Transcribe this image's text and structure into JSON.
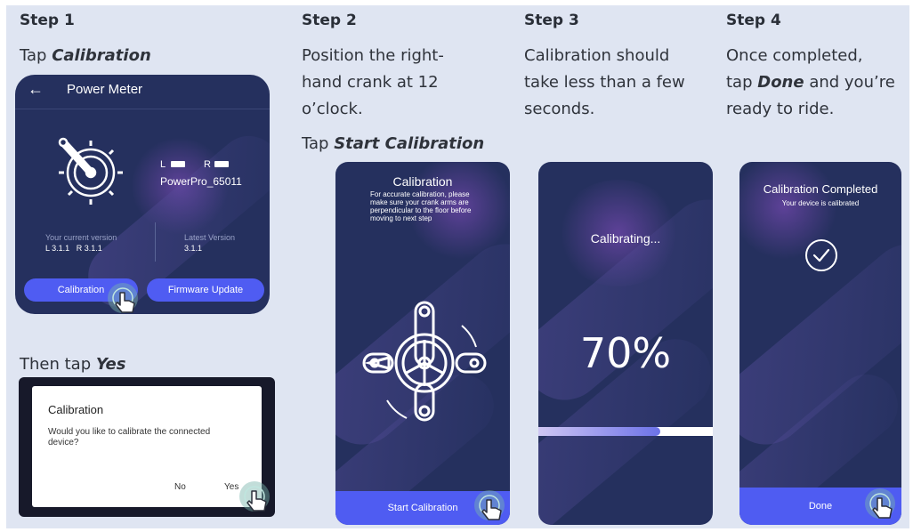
{
  "steps": [
    {
      "title": "Step 1",
      "tap_prefix": "Tap ",
      "tap_emph": "Calibration",
      "then_prefix": "Then tap ",
      "then_emph": "Yes"
    },
    {
      "title": "Step 2",
      "line1": "Position the right-",
      "line2": "hand crank at 12",
      "line3": "o’clock.",
      "tap_prefix": "Tap ",
      "tap_emph": "Start Calibration"
    },
    {
      "title": "Step 3",
      "line1": "Calibration should",
      "line2": "take less than a few",
      "line3": "seconds."
    },
    {
      "title": "Step 4",
      "line1": "Once completed,",
      "line2_prefix": "tap ",
      "line2_emph": "Done",
      "line2_suffix": " and you’re",
      "line3": "ready to ride."
    }
  ],
  "screen1": {
    "back_glyph": "←",
    "header": "Power Meter",
    "left_label": "L",
    "right_label": "R",
    "device_name": "PowerPro_65011",
    "current_version_label": "Your current version",
    "current_version_value": "L 3.1.1   R 3.1.1",
    "latest_version_label": "Latest Version",
    "latest_version_value": "3.1.1",
    "calibration_button": "Calibration",
    "firmware_button": "Firmware Update"
  },
  "dialog": {
    "title": "Calibration",
    "message": "Would you like to calibrate the connected device?",
    "no": "No",
    "yes": "Yes"
  },
  "screen2": {
    "title": "Calibration",
    "instructions": "For accurate calibration, please make sure your crank arms are perpendicular to the floor before moving to next step",
    "button": "Start Calibration"
  },
  "screen3": {
    "status": "Calibrating...",
    "percent": "70%",
    "progress": 0.7
  },
  "screen4": {
    "title": "Calibration Completed",
    "subtitle": "Your device is calibrated",
    "button": "Done"
  },
  "colors": {
    "panel": "#dfe5f2",
    "screen": "#25305e",
    "accent": "#4f5cf2"
  }
}
